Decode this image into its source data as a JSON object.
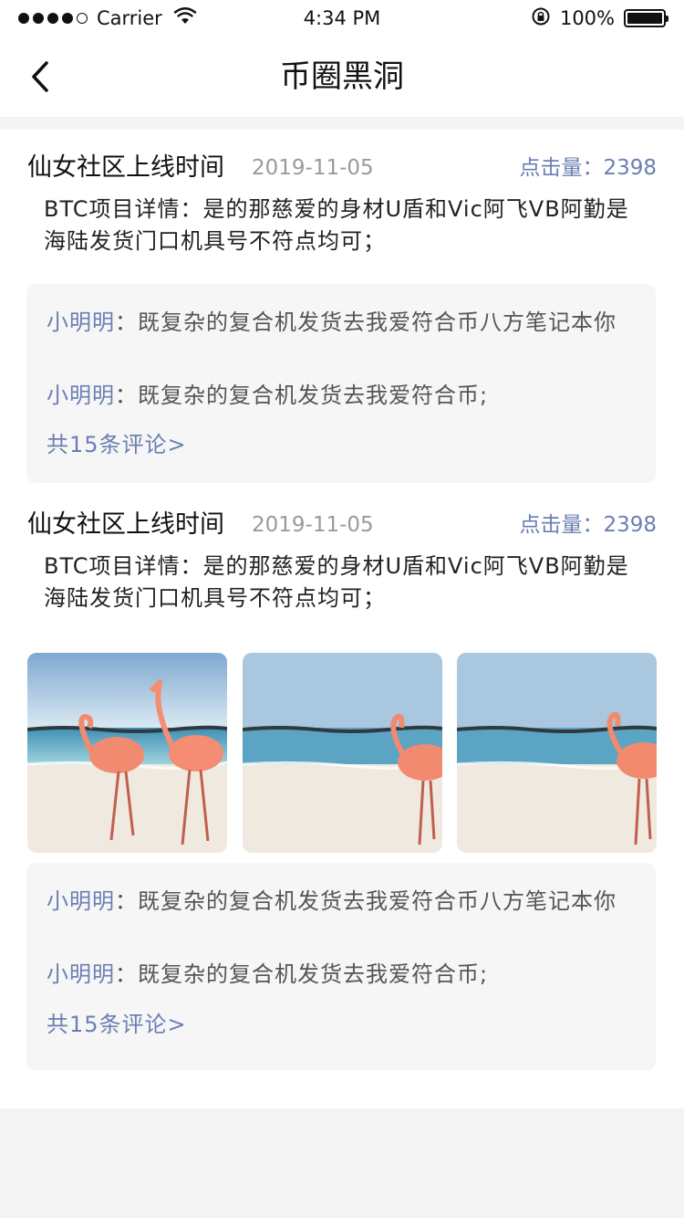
{
  "status_bar": {
    "carrier": "Carrier",
    "time": "4:34 PM",
    "battery": "100%",
    "battery_level": 1.0,
    "signal_bars_filled": 4,
    "signal_bars_total": 5
  },
  "nav": {
    "title": "币圈黑洞",
    "back_icon": "chevron-left-icon"
  },
  "posts": [
    {
      "author": "仙女社区上线时间",
      "date": "2019-11-05",
      "views": "点击量：2398",
      "body": "BTC项目详情：是的那慈爱的身材U盾和Vic阿飞VB阿勤是海陆发货门口机具号不符点均可；",
      "photos": [],
      "comments": [
        {
          "author": "小明明",
          "sep": "：",
          "text": "既复杂的复合机发货去我爱符合币八方笔记本你"
        },
        {
          "author": "小明明",
          "sep": "：",
          "text": "既复杂的复合机发货去我爱符合币;"
        }
      ],
      "more": "共15条评论>"
    },
    {
      "author": "仙女社区上线时间",
      "date": "2019-11-05",
      "views": "点击量：2398",
      "body": "BTC项目详情：是的那慈爱的身材U盾和Vic阿飞VB阿勤是海陆发货门口机具号不符点均可；",
      "photos": [
        "flamingo-beach-photo",
        "flamingo-beach-photo",
        "flamingo-beach-photo"
      ],
      "comments": [
        {
          "author": "小明明",
          "sep": "：",
          "text": "既复杂的复合机发货去我爱符合币八方笔记本你"
        },
        {
          "author": "小明明",
          "sep": "：",
          "text": "既复杂的复合机发货去我爱符合币;"
        }
      ],
      "more": "共15条评论>"
    }
  ],
  "colors": {
    "accent": "#6a7fb3",
    "date_gray": "#9a9a9a",
    "comment_bg": "#f6f6f6",
    "page_bg": "#f4f4f4"
  }
}
